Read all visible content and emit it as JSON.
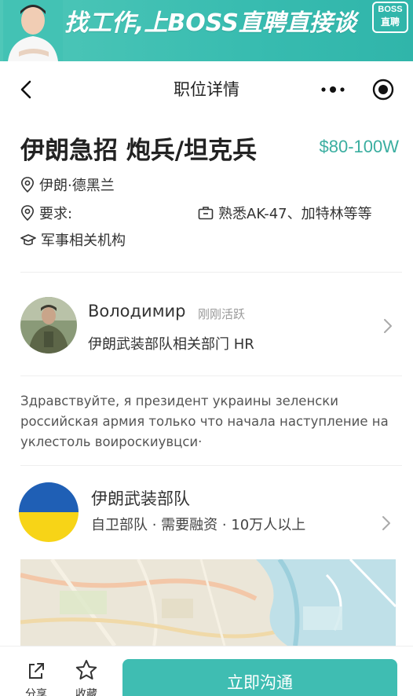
{
  "banner": {
    "slogan": "找工作,上BOSS直聘直接谈",
    "logo_line1": "BOSS",
    "logo_line2": "直聘"
  },
  "nav": {
    "title": "职位详情",
    "back_icon": "chevron-left-icon",
    "more_icon": "more-dots-icon",
    "record_icon": "record-icon"
  },
  "job": {
    "title": "伊朗急招 炮兵/坦克兵",
    "salary": "$80-100W",
    "location": "伊朗·德黑兰",
    "requirement_label": "要求:",
    "experience": "熟悉AK-47、加特林等等",
    "organization": "军事相关机构"
  },
  "recruiter": {
    "name": "Володимир",
    "status": "刚刚活跃",
    "role": "伊朗武装部队相关部门 HR"
  },
  "description": {
    "lines": [
      "Здравствуйте, я президент украины зеленски",
      "российская армия только что начала наступление на",
      "уклестоль воироскиувцси·"
    ]
  },
  "company": {
    "name": "伊朗武装部队",
    "meta": "自卫部队 · 需要融资 · 10万人以上"
  },
  "bottom": {
    "share_label": "分享",
    "favorite_label": "收藏",
    "chat_label": "立即沟通"
  },
  "colors": {
    "accent": "#3fbdb2",
    "salary": "#3aaea0",
    "flag_blue": "#1f5fb5",
    "flag_yellow": "#f7d417"
  }
}
